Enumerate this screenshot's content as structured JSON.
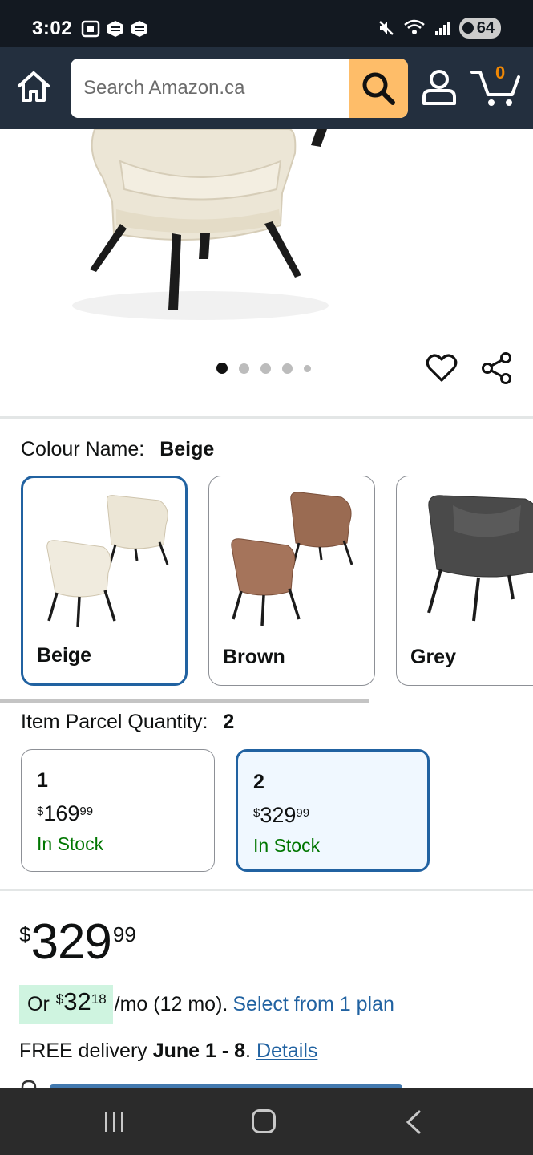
{
  "status_bar": {
    "time": "3:02",
    "battery": "64"
  },
  "header": {
    "search_placeholder": "Search Amazon.ca",
    "cart_count": "0",
    "accent_color": "#febd69",
    "background_color": "#232f3e"
  },
  "carousel": {
    "total_dots": 5,
    "active_index": 0
  },
  "colour": {
    "label": "Colour Name:",
    "selected": "Beige",
    "options": [
      {
        "name": "Beige",
        "selected": true
      },
      {
        "name": "Brown",
        "selected": false
      },
      {
        "name": "Grey",
        "selected": false
      }
    ]
  },
  "quantity": {
    "label": "Item Parcel Quantity:",
    "selected": "2",
    "options": [
      {
        "qty": "1",
        "currency": "$",
        "whole": "169",
        "fraction": "99",
        "stock": "In Stock",
        "selected": false
      },
      {
        "qty": "2",
        "currency": "$",
        "whole": "329",
        "fraction": "99",
        "stock": "In Stock",
        "selected": true
      }
    ]
  },
  "price": {
    "currency": "$",
    "whole": "329",
    "fraction": "99"
  },
  "monthly": {
    "prefix": "Or",
    "currency": "$",
    "whole": "32",
    "fraction": "18",
    "suffix": "/mo (12 mo).",
    "link": "Select from 1 plan"
  },
  "delivery": {
    "prefix": "FREE delivery",
    "date": "June 1 - 8",
    "separator": ".",
    "details_link": "Details"
  }
}
